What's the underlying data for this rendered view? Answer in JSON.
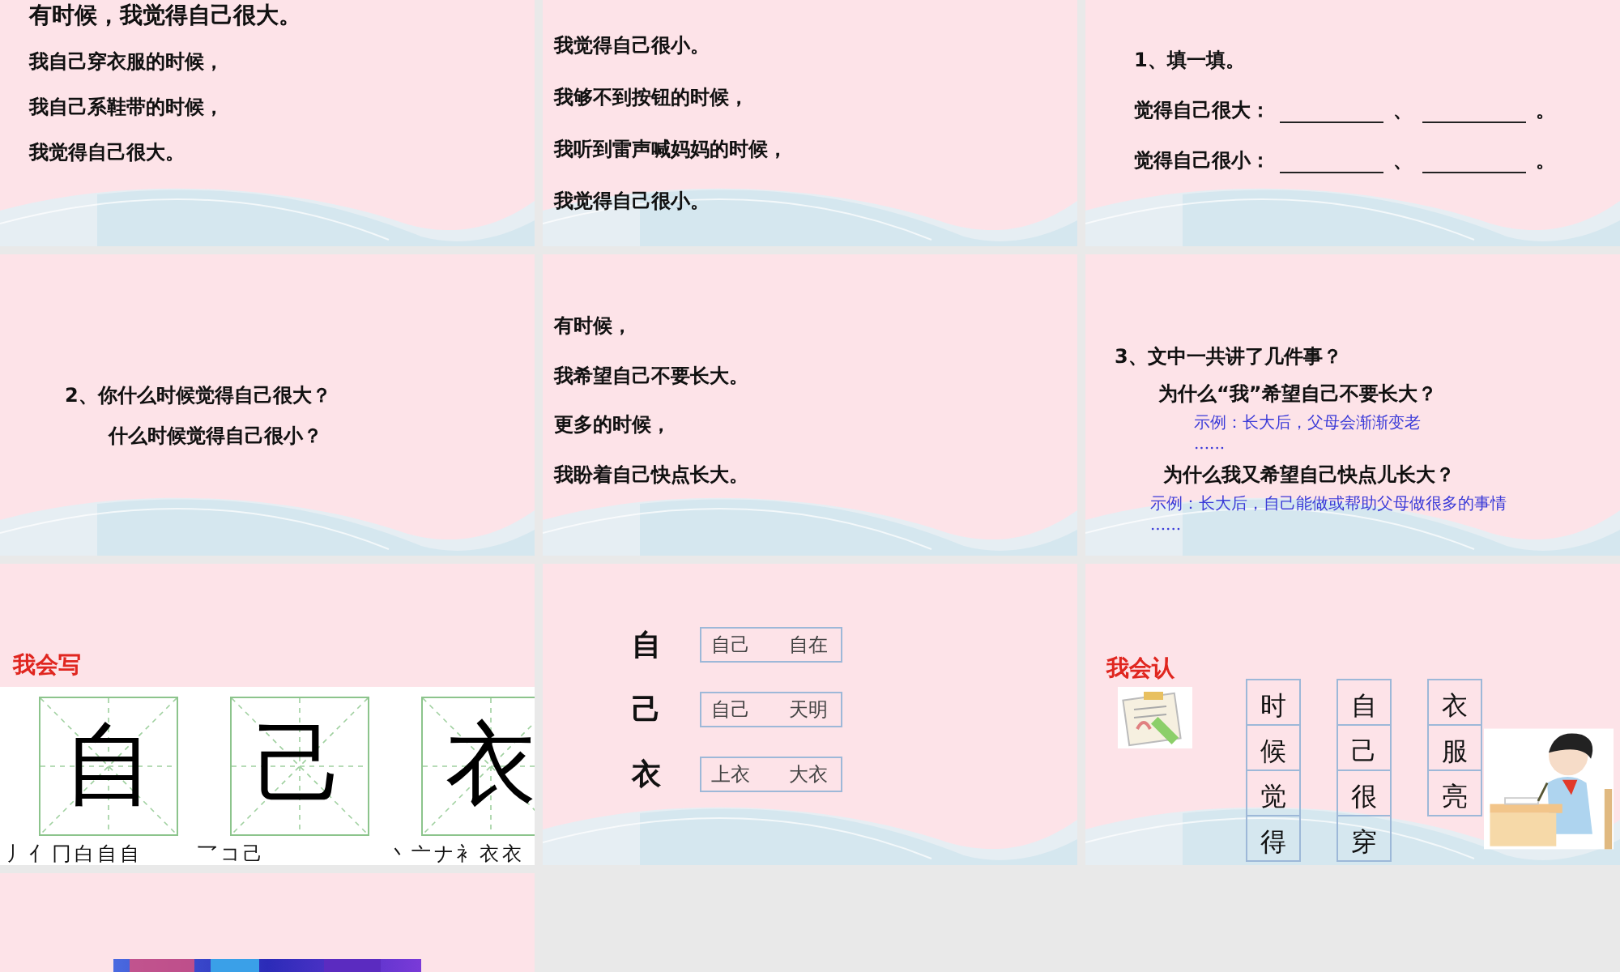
{
  "slides": [
    {
      "kind": "lines",
      "lines": [
        "有时候，我觉得自己很大。",
        "我自己穿衣服的时候，",
        "我自己系鞋带的时候，",
        "我觉得自己很大。"
      ]
    },
    {
      "kind": "lines",
      "lines": [
        "我觉得自己很小。",
        "我够不到按钮的时候，",
        "我听到雷声喊妈妈的时候，",
        "我觉得自己很小。"
      ]
    },
    {
      "kind": "fill",
      "title": "1、填一填。",
      "rows": [
        {
          "label": "觉得自己很大：",
          "separator": "、",
          "end": "。"
        },
        {
          "label": "觉得自己很小：",
          "separator": "、",
          "end": "。"
        }
      ]
    },
    {
      "kind": "question",
      "lines": [
        "2、你什么时候觉得自己很大？",
        "什么时候觉得自己很小？"
      ]
    },
    {
      "kind": "lines",
      "lines": [
        "有时候，",
        "我希望自己不要长大。",
        "更多的时候，",
        "我盼着自己快点长大。"
      ]
    },
    {
      "kind": "qa",
      "title": "3、文中一共讲了几件事？",
      "items": [
        {
          "question": "为什么“我”希望自己不要长大？",
          "answer": "示例：长大后，父母会渐渐变老 ......"
        },
        {
          "question": "为什么我又希望自己快点儿长大？",
          "answer": "示例：长大后，自己能做或帮助父母做很多的事情 ......"
        }
      ]
    },
    {
      "kind": "write",
      "heading": "我会写",
      "chars": [
        {
          "char": "自",
          "strokes": "丿亻冂白自自"
        },
        {
          "char": "己",
          "strokes": "乛コ己"
        },
        {
          "char": "衣",
          "strokes": "丶亠ナ衤衣衣"
        }
      ]
    },
    {
      "kind": "words",
      "items": [
        {
          "char": "自",
          "word": "自己　　自在"
        },
        {
          "char": "己",
          "word": "自己　　天明"
        },
        {
          "char": "衣",
          "word": "上衣　　大衣"
        }
      ]
    },
    {
      "kind": "read",
      "heading": "我会认",
      "columns": [
        [
          "时",
          "候",
          "觉",
          "得"
        ],
        [
          "自",
          "己",
          "很",
          "穿"
        ],
        [
          "衣",
          "服",
          "亮"
        ]
      ]
    },
    {
      "kind": "media"
    }
  ]
}
